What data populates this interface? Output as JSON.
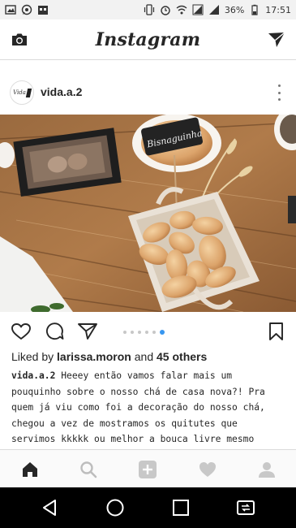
{
  "status_bar": {
    "battery": "36%",
    "time": "17:51"
  },
  "header": {
    "logo": "Instagram",
    "icons": [
      "camera-icon",
      "direct-message-icon"
    ]
  },
  "post": {
    "username": "vida.a.2",
    "avatar_text": "Vida",
    "photo_sign_text": "Bisnaguinha",
    "carousel": {
      "count": 6,
      "active_index": 5
    },
    "likes": {
      "prefix": "Liked by ",
      "liker": "larissa.moron",
      "and": " and ",
      "others": "45 others"
    },
    "caption": {
      "author": "vida.a.2",
      "text": "Heeey então vamos falar mais um pouquinho sobre o nosso chá de casa nova?! Pra quem já viu como foi a decoração do nosso chá, chegou a vez de mostramos os quitutes que servimos kkkkk ou melhor a bouca livre mesmo kkkkk"
    }
  },
  "bottom_nav": {
    "items": [
      "home-icon",
      "search-icon",
      "add-post-icon",
      "activity-heart-icon",
      "profile-icon"
    ],
    "active": "home-icon"
  },
  "system_nav": {
    "items": [
      "back-icon",
      "home-circle-icon",
      "recents-icon",
      "switch-app-icon"
    ]
  }
}
